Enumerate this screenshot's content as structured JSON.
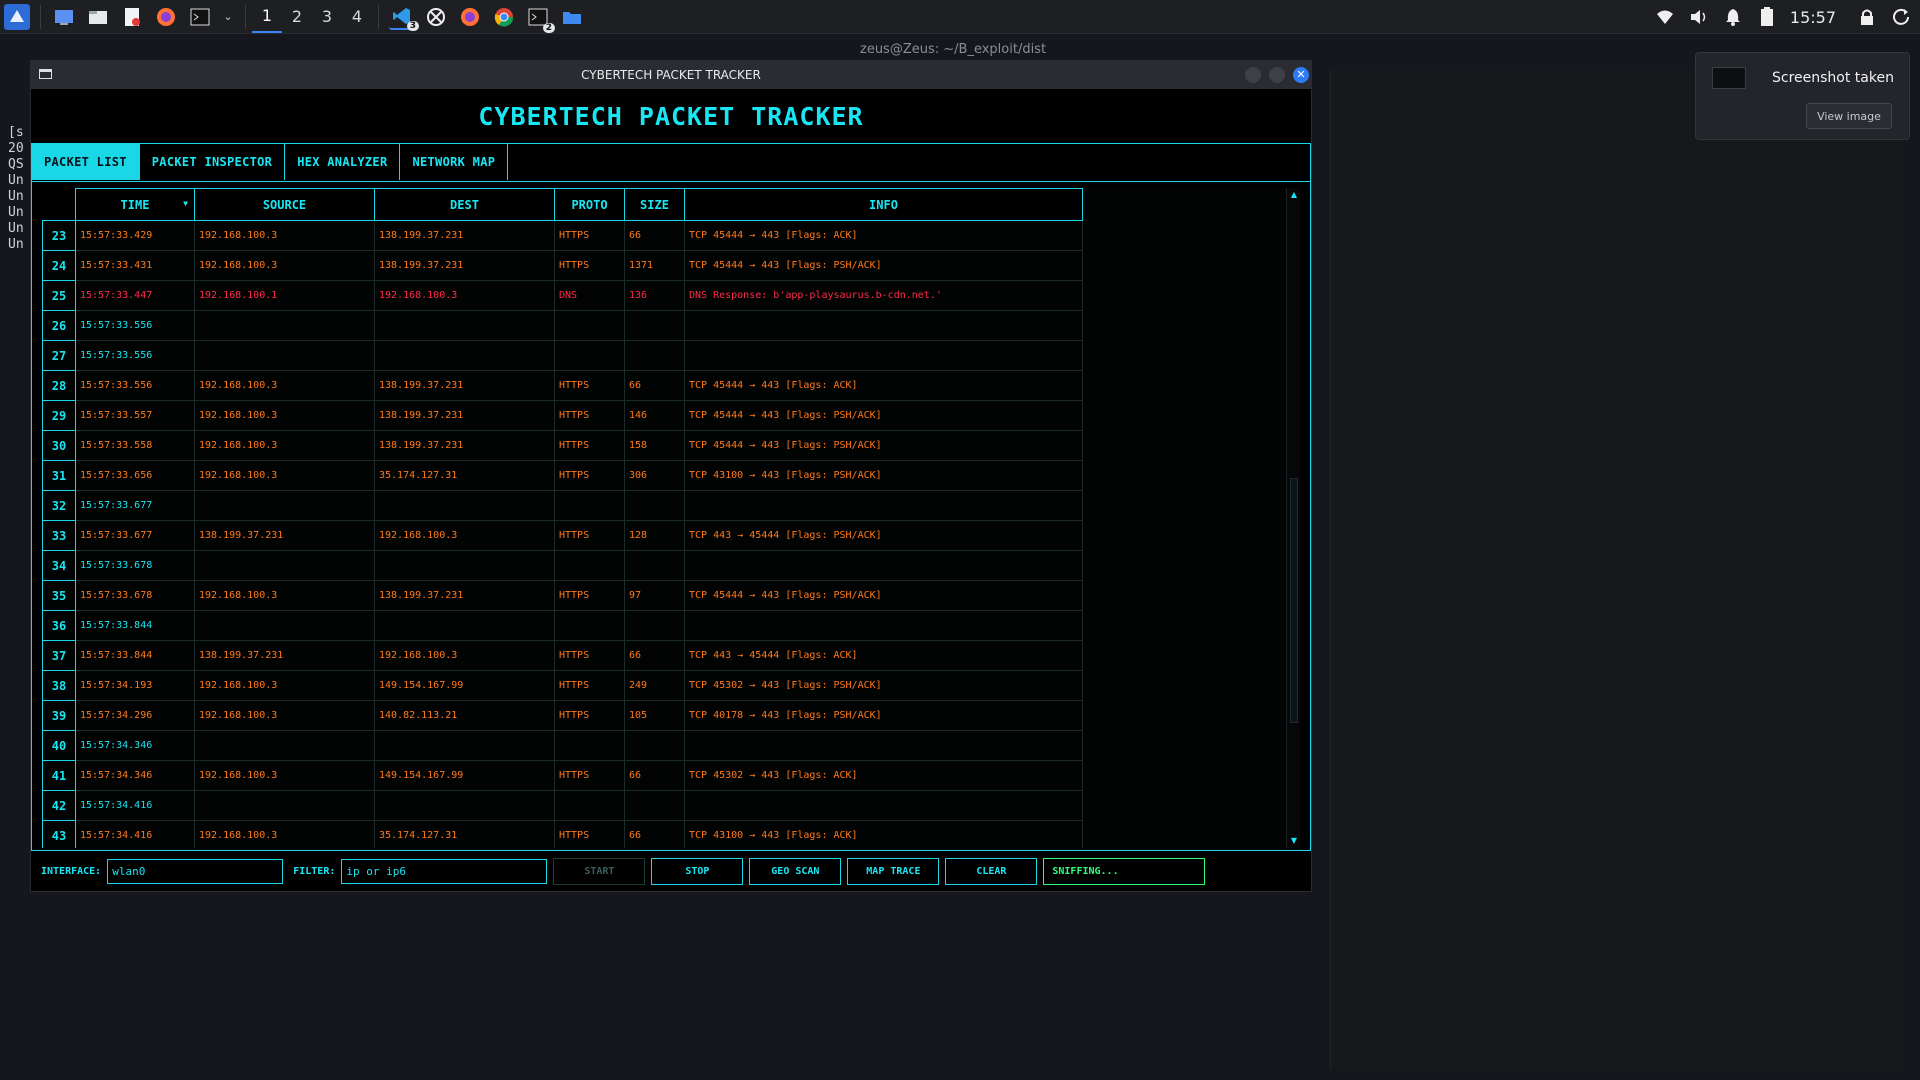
{
  "taskbar": {
    "workspaces": [
      "1",
      "2",
      "3",
      "4"
    ],
    "active_workspace": "1",
    "vscode_badge": "3",
    "terminal_badge": "2",
    "clock": "15:57"
  },
  "background": {
    "terminal_title": "zeus@Zeus: ~/B_exploit/dist",
    "terminal_lines": [
      "[s",
      "20",
      "QS",
      "Un",
      "Un",
      "Un",
      "Un",
      "Un"
    ]
  },
  "notification": {
    "title": "Screenshot taken",
    "button": "View image"
  },
  "app": {
    "window_title": "CYBERTECH PACKET TRACKER",
    "header": "CYBERTECH PACKET TRACKER",
    "tabs": [
      "PACKET LIST",
      "PACKET INSPECTOR",
      "HEX ANALYZER",
      "NETWORK MAP"
    ],
    "active_tab": "PACKET LIST",
    "columns": [
      "TIME",
      "SOURCE",
      "DEST",
      "PROTO",
      "SIZE",
      "INFO"
    ],
    "rows": [
      {
        "n": "23",
        "time": "15:57:33.429",
        "src": "192.168.100.3",
        "dst": "138.199.37.231",
        "proto": "HTTPS",
        "size": "66",
        "info": "TCP 45444 → 443 [Flags: ACK]",
        "kind": "normal"
      },
      {
        "n": "24",
        "time": "15:57:33.431",
        "src": "192.168.100.3",
        "dst": "138.199.37.231",
        "proto": "HTTPS",
        "size": "1371",
        "info": "TCP 45444 → 443 [Flags: PSH/ACK]",
        "kind": "normal"
      },
      {
        "n": "25",
        "time": "15:57:33.447",
        "src": "192.168.100.1",
        "dst": "192.168.100.3",
        "proto": "DNS",
        "size": "136",
        "info": "DNS Response: b'app-playsaurus.b-cdn.net.'",
        "kind": "alert"
      },
      {
        "n": "26",
        "time": "15:57:33.556",
        "src": "",
        "dst": "",
        "proto": "",
        "size": "",
        "info": "",
        "kind": "blank"
      },
      {
        "n": "27",
        "time": "15:57:33.556",
        "src": "",
        "dst": "",
        "proto": "",
        "size": "",
        "info": "",
        "kind": "blank"
      },
      {
        "n": "28",
        "time": "15:57:33.556",
        "src": "192.168.100.3",
        "dst": "138.199.37.231",
        "proto": "HTTPS",
        "size": "66",
        "info": "TCP 45444 → 443 [Flags: ACK]",
        "kind": "normal"
      },
      {
        "n": "29",
        "time": "15:57:33.557",
        "src": "192.168.100.3",
        "dst": "138.199.37.231",
        "proto": "HTTPS",
        "size": "146",
        "info": "TCP 45444 → 443 [Flags: PSH/ACK]",
        "kind": "normal"
      },
      {
        "n": "30",
        "time": "15:57:33.558",
        "src": "192.168.100.3",
        "dst": "138.199.37.231",
        "proto": "HTTPS",
        "size": "158",
        "info": "TCP 45444 → 443 [Flags: PSH/ACK]",
        "kind": "normal"
      },
      {
        "n": "31",
        "time": "15:57:33.656",
        "src": "192.168.100.3",
        "dst": "35.174.127.31",
        "proto": "HTTPS",
        "size": "306",
        "info": "TCP 43100 → 443 [Flags: PSH/ACK]",
        "kind": "normal"
      },
      {
        "n": "32",
        "time": "15:57:33.677",
        "src": "",
        "dst": "",
        "proto": "",
        "size": "",
        "info": "",
        "kind": "blank"
      },
      {
        "n": "33",
        "time": "15:57:33.677",
        "src": "138.199.37.231",
        "dst": "192.168.100.3",
        "proto": "HTTPS",
        "size": "128",
        "info": "TCP 443 → 45444 [Flags: PSH/ACK]",
        "kind": "normal"
      },
      {
        "n": "34",
        "time": "15:57:33.678",
        "src": "",
        "dst": "",
        "proto": "",
        "size": "",
        "info": "",
        "kind": "blank"
      },
      {
        "n": "35",
        "time": "15:57:33.678",
        "src": "192.168.100.3",
        "dst": "138.199.37.231",
        "proto": "HTTPS",
        "size": "97",
        "info": "TCP 45444 → 443 [Flags: PSH/ACK]",
        "kind": "normal"
      },
      {
        "n": "36",
        "time": "15:57:33.844",
        "src": "",
        "dst": "",
        "proto": "",
        "size": "",
        "info": "",
        "kind": "blank"
      },
      {
        "n": "37",
        "time": "15:57:33.844",
        "src": "138.199.37.231",
        "dst": "192.168.100.3",
        "proto": "HTTPS",
        "size": "66",
        "info": "TCP 443 → 45444 [Flags: ACK]",
        "kind": "normal"
      },
      {
        "n": "38",
        "time": "15:57:34.193",
        "src": "192.168.100.3",
        "dst": "149.154.167.99",
        "proto": "HTTPS",
        "size": "249",
        "info": "TCP 45302 → 443 [Flags: PSH/ACK]",
        "kind": "normal"
      },
      {
        "n": "39",
        "time": "15:57:34.296",
        "src": "192.168.100.3",
        "dst": "140.82.113.21",
        "proto": "HTTPS",
        "size": "105",
        "info": "TCP 40178 → 443 [Flags: PSH/ACK]",
        "kind": "normal"
      },
      {
        "n": "40",
        "time": "15:57:34.346",
        "src": "",
        "dst": "",
        "proto": "",
        "size": "",
        "info": "",
        "kind": "blank"
      },
      {
        "n": "41",
        "time": "15:57:34.346",
        "src": "192.168.100.3",
        "dst": "149.154.167.99",
        "proto": "HTTPS",
        "size": "66",
        "info": "TCP 45302 → 443 [Flags: ACK]",
        "kind": "normal"
      },
      {
        "n": "42",
        "time": "15:57:34.416",
        "src": "",
        "dst": "",
        "proto": "",
        "size": "",
        "info": "",
        "kind": "blank"
      },
      {
        "n": "43",
        "time": "15:57:34.416",
        "src": "192.168.100.3",
        "dst": "35.174.127.31",
        "proto": "HTTPS",
        "size": "66",
        "info": "TCP 43100 → 443 [Flags: ACK]",
        "kind": "normal"
      }
    ],
    "controls": {
      "interface_label": "INTERFACE:",
      "interface_value": "wlan0",
      "filter_label": "FILTER:",
      "filter_value": "ip or ip6",
      "start": "START",
      "stop": "STOP",
      "geo_scan": "GEO SCAN",
      "map_trace": "MAP TRACE",
      "clear": "CLEAR",
      "status": "SNIFFING..."
    }
  },
  "colors": {
    "accent": "#19d7e6",
    "packet_text": "#ff7a1a",
    "alert_text": "#ff2b4a",
    "status_ok": "#2bff7a"
  }
}
